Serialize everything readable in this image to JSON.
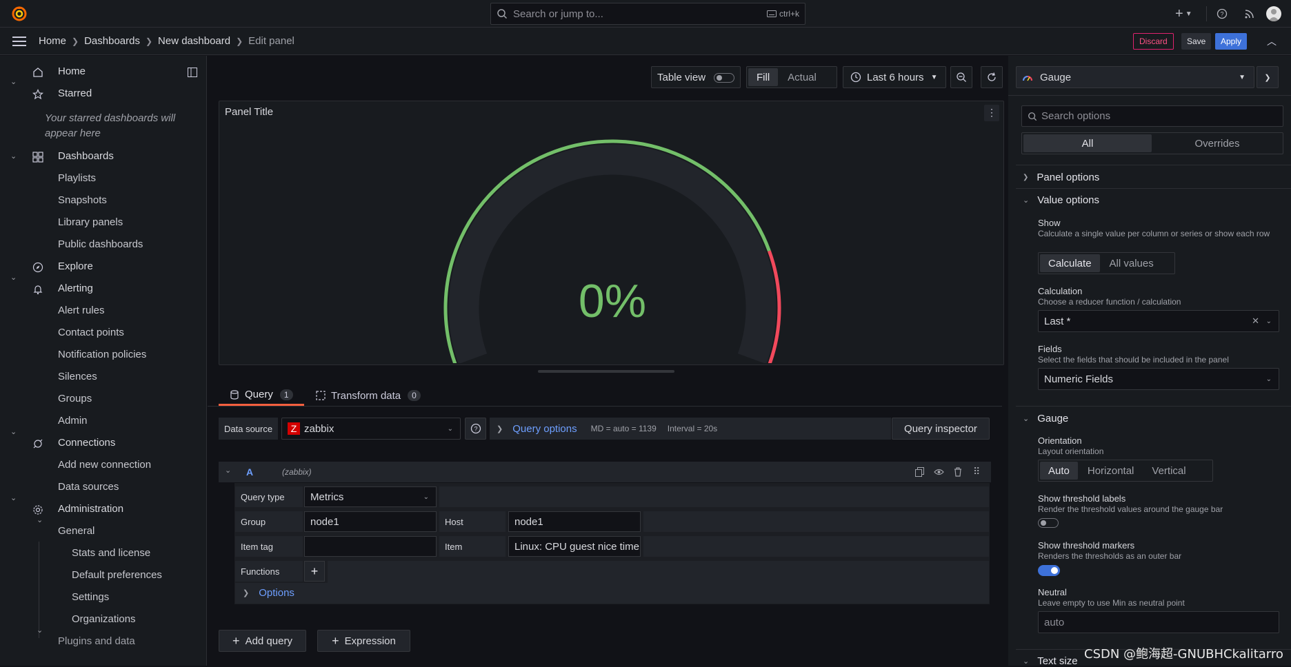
{
  "topbar": {
    "search_placeholder": "Search or jump to...",
    "search_shortcut": "ctrl+k"
  },
  "breadcrumb": [
    "Home",
    "Dashboards",
    "New dashboard",
    "Edit panel"
  ],
  "actions": {
    "discard": "Discard",
    "save": "Save",
    "apply": "Apply"
  },
  "sidebar": {
    "home": "Home",
    "starred": "Starred",
    "starred_empty": "Your starred dashboards will appear here",
    "dashboards": "Dashboards",
    "dashboards_children": [
      "Playlists",
      "Snapshots",
      "Library panels",
      "Public dashboards"
    ],
    "explore": "Explore",
    "alerting": "Alerting",
    "alerting_children": [
      "Alert rules",
      "Contact points",
      "Notification policies",
      "Silences",
      "Groups",
      "Admin"
    ],
    "connections": "Connections",
    "connections_children": [
      "Add new connection",
      "Data sources"
    ],
    "administration": "Administration",
    "general": "General",
    "general_children": [
      "Stats and license",
      "Default preferences",
      "Settings",
      "Organizations"
    ],
    "plugins": "Plugins and data"
  },
  "toolbar": {
    "table_view": "Table view",
    "fill": "Fill",
    "actual": "Actual",
    "time_range": "Last 6 hours"
  },
  "panel": {
    "title": "Panel Title",
    "value": "0%",
    "gauge_fraction": 0,
    "colors": {
      "green": "#73bf69",
      "red": "#f2495c",
      "track": "#22252b"
    }
  },
  "tabs": {
    "query_label": "Query",
    "query_count": "1",
    "transform_label": "Transform data",
    "transform_count": "0"
  },
  "datasource": {
    "label": "Data source",
    "value": "zabbix",
    "query_options": "Query options",
    "md": "MD = auto = 1139",
    "interval": "Interval = 20s",
    "inspector": "Query inspector"
  },
  "query": {
    "ref": "A",
    "source": "(zabbix)",
    "query_type_label": "Query type",
    "query_type_value": "Metrics",
    "group_label": "Group",
    "group_value": "node1",
    "host_label": "Host",
    "host_value": "node1",
    "item_tag_label": "Item tag",
    "item_tag_value": "",
    "item_label": "Item",
    "item_value": "Linux: CPU guest nice time",
    "functions_label": "Functions",
    "options_label": "Options"
  },
  "bottom_buttons": {
    "add_query": "Add query",
    "expression": "Expression"
  },
  "options_pane": {
    "visualization": "Gauge",
    "search_placeholder": "Search options",
    "tab_all": "All",
    "tab_overrides": "Overrides",
    "panel_options": "Panel options",
    "value_options": "Value options",
    "show_label": "Show",
    "show_desc": "Calculate a single value per column or series or show each row",
    "show_calculate": "Calculate",
    "show_all_values": "All values",
    "calc_label": "Calculation",
    "calc_desc": "Choose a reducer function / calculation",
    "calc_value": "Last *",
    "fields_label": "Fields",
    "fields_desc": "Select the fields that should be included in the panel",
    "fields_value": "Numeric Fields",
    "gauge_section": "Gauge",
    "orientation_label": "Orientation",
    "orientation_desc": "Layout orientation",
    "orient_auto": "Auto",
    "orient_horizontal": "Horizontal",
    "orient_vertical": "Vertical",
    "threshold_labels_label": "Show threshold labels",
    "threshold_labels_desc": "Render the threshold values around the gauge bar",
    "threshold_markers_label": "Show threshold markers",
    "threshold_markers_desc": "Renders the thresholds as an outer bar",
    "neutral_label": "Neutral",
    "neutral_desc": "Leave empty to use Min as neutral point",
    "neutral_placeholder": "auto",
    "text_size": "Text size"
  },
  "watermark": "CSDN @鲍海超-GNUBHCkalitarro"
}
